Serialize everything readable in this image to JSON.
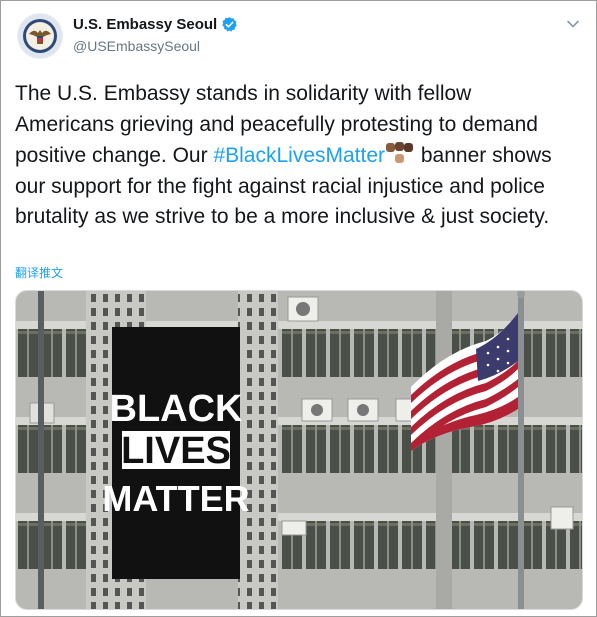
{
  "author": {
    "display_name": "U.S. Embassy Seoul",
    "handle": "@USEmbassySeoul",
    "verified": true
  },
  "tweet": {
    "text_before": "The U.S. Embassy stands in solidarity with fellow Americans grieving and peacefully protesting to demand positive change. Our ",
    "hashtag": "#BlackLivesMatter",
    "text_after": " banner shows our support for the fight against racial injustice and police brutality as we strive to be a more inclusive & just society.",
    "translate_link": "翻译推文"
  },
  "banner": {
    "line1": "BLACK",
    "line2": "LIVES",
    "line3": "MATTER"
  },
  "icons": {
    "avatar": "embassy-seal-icon",
    "verified": "verified-badge-icon",
    "menu": "chevron-down-icon",
    "emoji": "raised-fists-emoji"
  },
  "colors": {
    "accent": "#1da1f2",
    "text": "#14171a",
    "muted": "#657786"
  }
}
